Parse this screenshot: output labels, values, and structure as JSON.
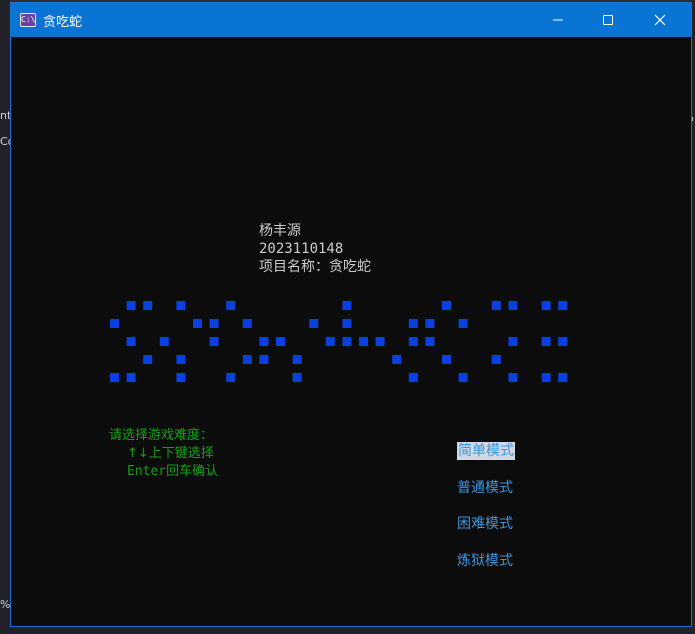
{
  "window": {
    "title": "贪吃蛇",
    "icon_label": "C:\\",
    "controls": {
      "minimize": "minimize-icon",
      "maximize": "maximize-icon",
      "close": "close-icon"
    }
  },
  "info": {
    "name": "杨丰源",
    "student_id": "2023110148",
    "project": "项目名称：贪吃蛇"
  },
  "logo": {
    "color": "#0a3fe0",
    "rows": [
      "0110100100000010000010011011",
      "1000011010001010001101000000",
      "0101001001100111101100001011",
      "0010100011010000010010010000",
      "1100100100010000001001001011"
    ]
  },
  "prompt": {
    "title": "请选择游戏难度：",
    "arrows": "↑↓上下键选择",
    "enter": "Enter回车确认",
    "color": "#13a10e"
  },
  "menu": {
    "selected_index": 0,
    "items": [
      "简单模式",
      "普通模式",
      "困难模式",
      "炼狱模式"
    ],
    "color": "#3a96dd"
  },
  "background": {
    "fragments": [
      "nt",
      "Co",
      "%",
      "o"
    ]
  }
}
